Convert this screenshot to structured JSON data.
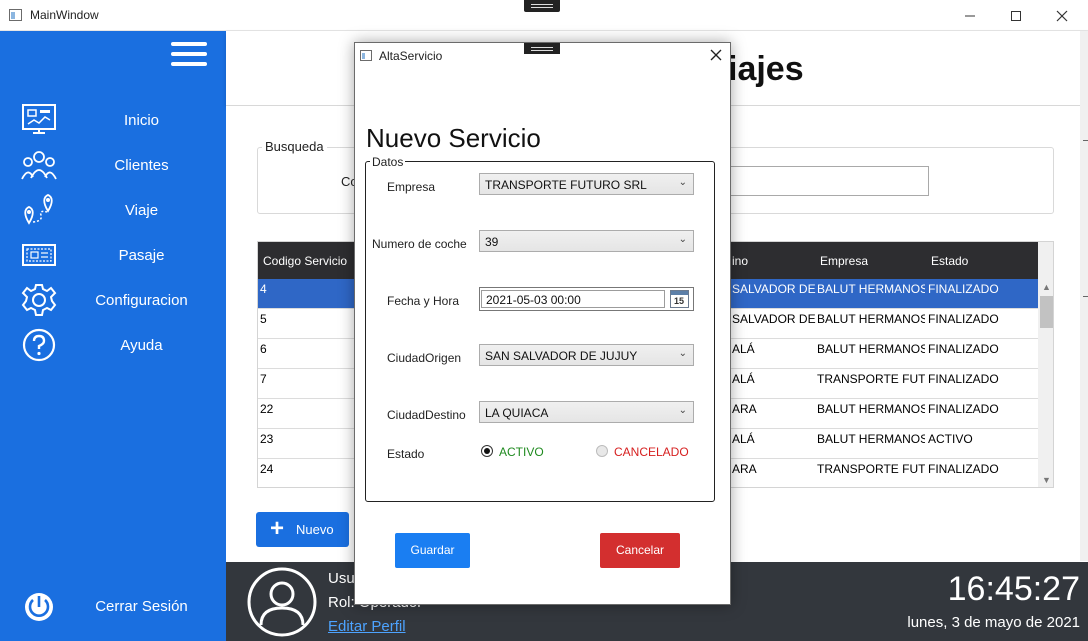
{
  "window": {
    "title": "MainWindow"
  },
  "sidebar": {
    "items": [
      {
        "label": "Inicio",
        "icon": "dashboard-icon"
      },
      {
        "label": "Clientes",
        "icon": "people-icon"
      },
      {
        "label": "Viaje",
        "icon": "route-pin-icon"
      },
      {
        "label": "Pasaje",
        "icon": "ticket-icon"
      },
      {
        "label": "Configuracion",
        "icon": "gear-icon"
      },
      {
        "label": "Ayuda",
        "icon": "help-icon"
      }
    ],
    "logout_label": "Cerrar Sesión"
  },
  "header": {
    "title": "iajes"
  },
  "search": {
    "legend": "Busqueda",
    "label": "Co"
  },
  "table": {
    "columns": [
      "Codigo Servicio",
      "ino",
      "Empresa",
      "Estado"
    ],
    "rows": [
      {
        "codigo": "4",
        "destino": "SALVADOR DE .",
        "empresa": "BALUT HERMANOS S",
        "estado": "FINALIZADO"
      },
      {
        "codigo": "5",
        "destino": "SALVADOR DE .",
        "empresa": "BALUT HERMANOS S",
        "estado": "FINALIZADO"
      },
      {
        "codigo": "6",
        "destino": "ALÁ",
        "empresa": "BALUT HERMANOS S",
        "estado": "FINALIZADO"
      },
      {
        "codigo": "7",
        "destino": "ALÁ",
        "empresa": "TRANSPORTE FUTUF",
        "estado": "FINALIZADO"
      },
      {
        "codigo": "22",
        "destino": "ARA",
        "empresa": "BALUT HERMANOS S",
        "estado": "FINALIZADO"
      },
      {
        "codigo": "23",
        "destino": "ALÁ",
        "empresa": "BALUT HERMANOS S",
        "estado": "ACTIVO"
      },
      {
        "codigo": "24",
        "destino": "ARA",
        "empresa": "TRANSPORTE FUTUF",
        "estado": "FINALIZADO"
      }
    ]
  },
  "new_button": {
    "label": "Nuevo"
  },
  "footer": {
    "user_line": "Usu",
    "role_line": "Rol: Operador",
    "edit_profile": "Editar Perfil",
    "time": "16:45:27",
    "date": "lunes, 3 de mayo de 2021"
  },
  "dialog": {
    "title": "AltaServicio",
    "heading": "Nuevo Servicio",
    "group": "Datos",
    "empresa": {
      "label": "Empresa",
      "value": "TRANSPORTE FUTURO SRL"
    },
    "coche": {
      "label": "Numero de coche",
      "value": "39"
    },
    "fecha": {
      "label": "Fecha y Hora",
      "value": "2021-05-03 00:00",
      "calendar_day": "15"
    },
    "origen": {
      "label": "CiudadOrigen",
      "value": "SAN SALVADOR DE JUJUY"
    },
    "destino": {
      "label": "CiudadDestino",
      "value": "LA QUIACA"
    },
    "estado": {
      "label": "Estado",
      "option_activo": "ACTIVO",
      "option_cancelado": "CANCELADO",
      "selected": "ACTIVO"
    },
    "save_label": "Guardar",
    "cancel_label": "Cancelar"
  },
  "colors": {
    "sidebar": "#1a6fe0",
    "footer": "#33373d",
    "table_header": "#2d2d30",
    "selected_row": "#2f67c6",
    "save_button": "#1a7ef2",
    "cancel_button": "#d32f2f",
    "activo_text": "#1f8a1f",
    "cancelado_text": "#d62020"
  }
}
